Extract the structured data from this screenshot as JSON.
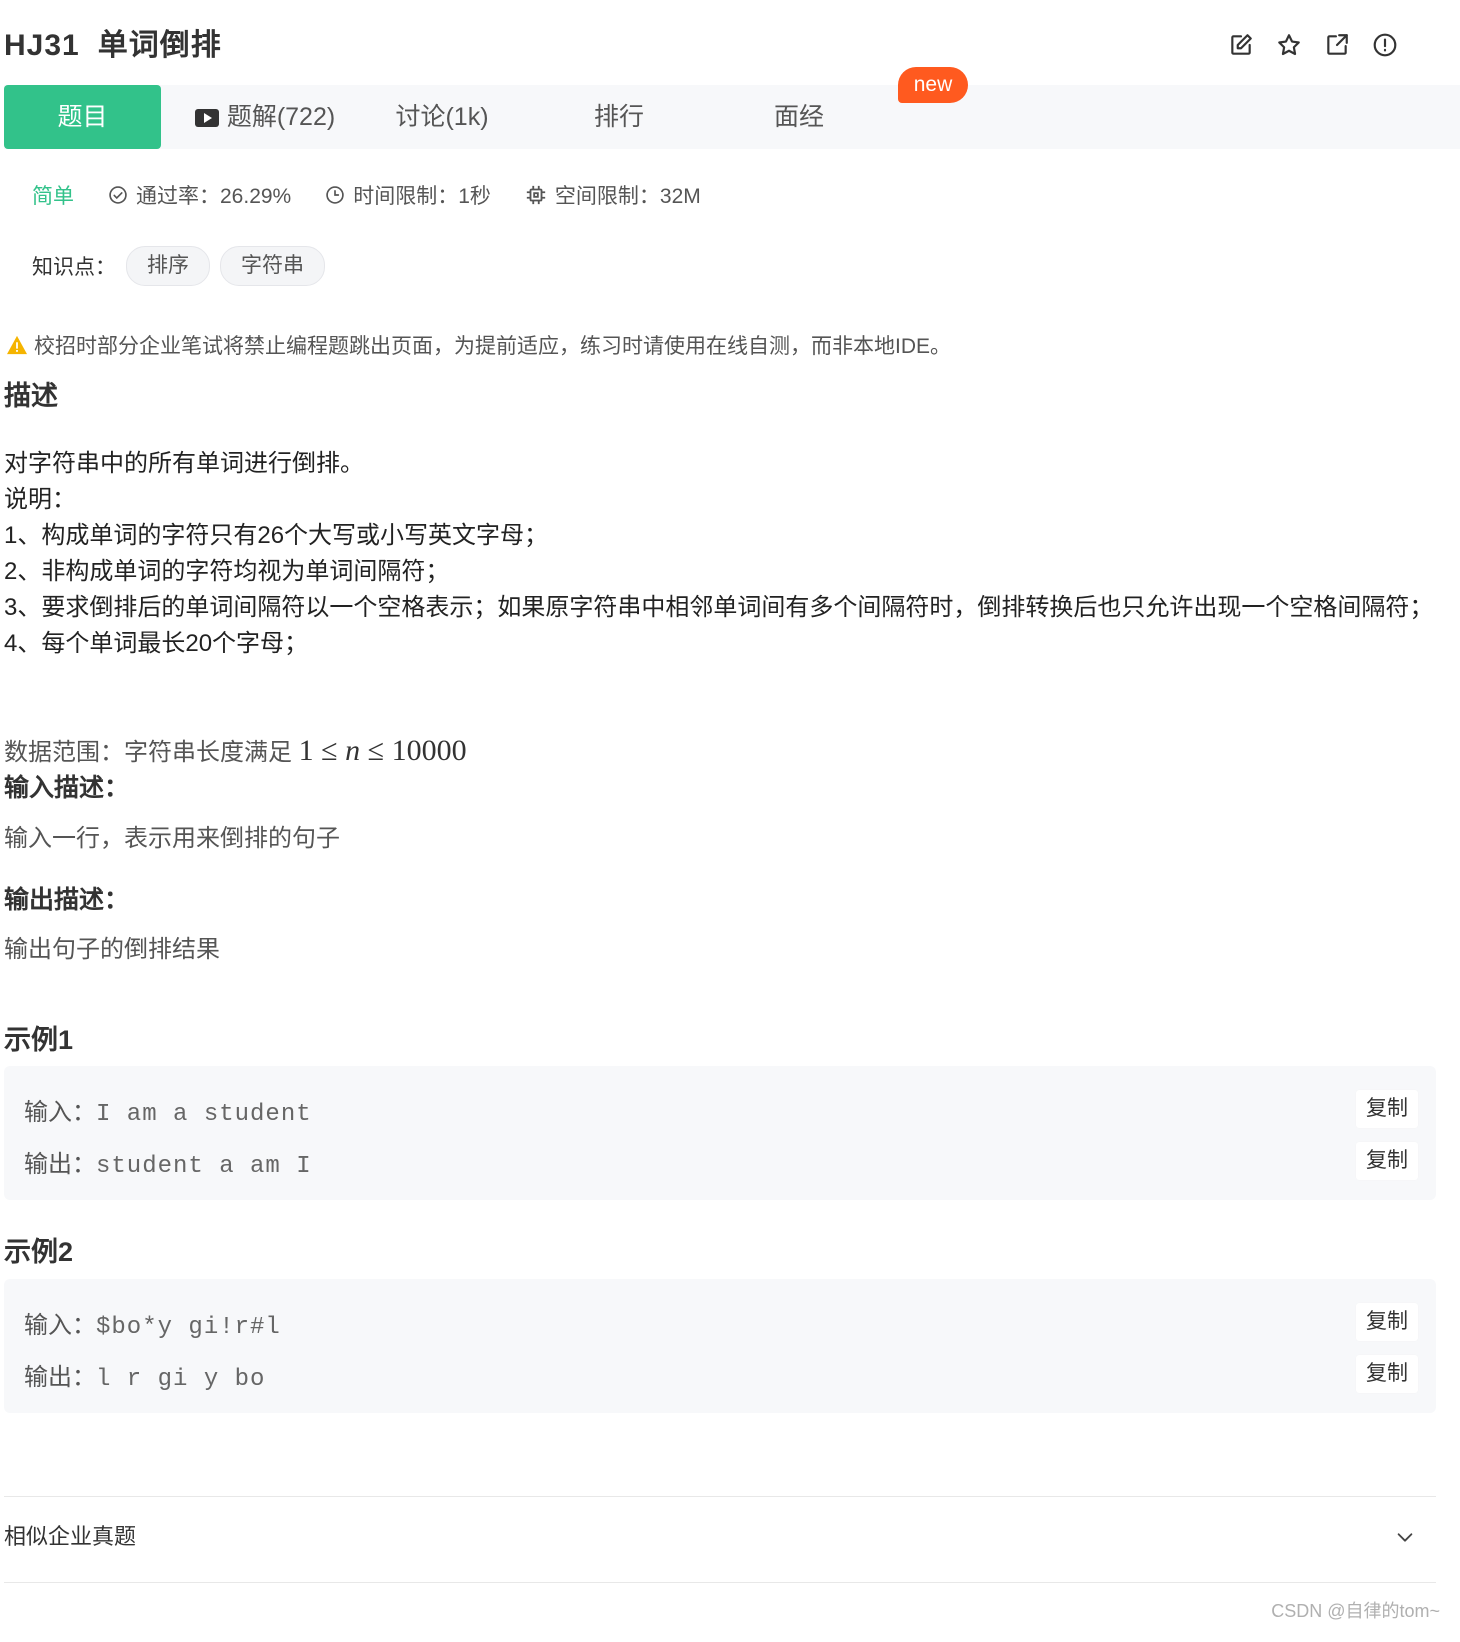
{
  "header": {
    "problem_code": "HJ31",
    "problem_name": "单词倒排",
    "icons": [
      "edit-icon",
      "star-icon",
      "share-icon",
      "report-icon"
    ]
  },
  "tabs": [
    {
      "label": "题目",
      "active": true
    },
    {
      "label": "题解(722)",
      "icon": "video-icon"
    },
    {
      "label": "讨论(1k)"
    },
    {
      "label": "排行"
    },
    {
      "label": "面经"
    }
  ],
  "new_badge": "new",
  "meta": {
    "difficulty": "简单",
    "pass_rate": "通过率：26.29%",
    "time_limit": "时间限制：1秒",
    "space_limit": "空间限制：32M"
  },
  "knowledge": {
    "label": "知识点：",
    "tags": [
      "排序",
      "字符串"
    ]
  },
  "warning": "校招时部分企业笔试将禁止编程题跳出页面，为提前适应，练习时请使用在线自测，而非本地IDE。",
  "description": {
    "heading": "描述",
    "lines": [
      "对字符串中的所有单词进行倒排。",
      "说明：",
      "1、构成单词的字符只有26个大写或小写英文字母；",
      "2、非构成单词的字符均视为单词间隔符；",
      "3、要求倒排后的单词间隔符以一个空格表示；如果原字符串中相邻单词间有多个间隔符时，倒排转换后也只允许出现一个空格间隔符；",
      "4、每个单词最长20个字母；"
    ],
    "range_label": "数据范围：字符串长度满足",
    "range_math": {
      "low": "1",
      "var": "n",
      "high": "10000",
      "op": "≤"
    }
  },
  "input_desc": {
    "heading": "输入描述：",
    "text": "输入一行，表示用来倒排的句子"
  },
  "output_desc": {
    "heading": "输出描述：",
    "text": "输出句子的倒排结果"
  },
  "examples": [
    {
      "title": "示例1",
      "input_label": "输入：",
      "input": "I am a student",
      "output_label": "输出：",
      "output": "student a am I",
      "copy": "复制"
    },
    {
      "title": "示例2",
      "input_label": "输入：",
      "input": "$bo*y gi!r#l",
      "output_label": "输出：",
      "output": "l r gi y bo",
      "copy": "复制"
    }
  ],
  "similar": {
    "label": "相似企业真题"
  },
  "watermark": "CSDN @自律的tom~",
  "colors": {
    "accent": "#32c28a",
    "badge": "#ff5a1f",
    "warning": "#f5b400"
  }
}
